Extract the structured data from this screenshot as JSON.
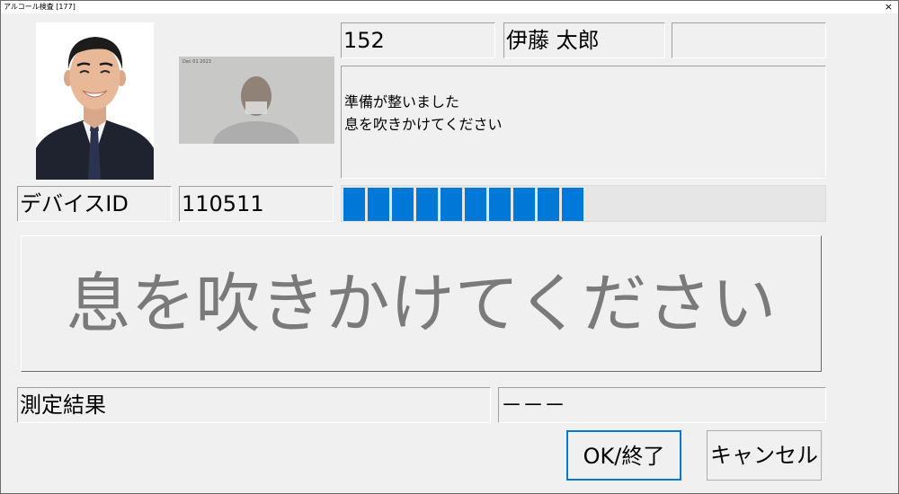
{
  "window": {
    "title": "アルコール検査 [177]",
    "close_glyph": "×"
  },
  "employee": {
    "id": "152",
    "name": "伊藤 太郎",
    "extra": ""
  },
  "camera": {
    "timestamp": "Dec 01 2023"
  },
  "message": {
    "line1": "準備が整いました",
    "line2": "息を吹きかけてください"
  },
  "device": {
    "label": "デバイスID",
    "id": "110511"
  },
  "progress": {
    "segments_filled": 10,
    "color": "#0078d7"
  },
  "instruction": {
    "text": "息を吹きかけてください",
    "color": "#7a7a7a"
  },
  "result": {
    "label": "測定結果",
    "value": "－－－"
  },
  "buttons": {
    "ok": "OK/終了",
    "cancel": "キャンセル"
  }
}
